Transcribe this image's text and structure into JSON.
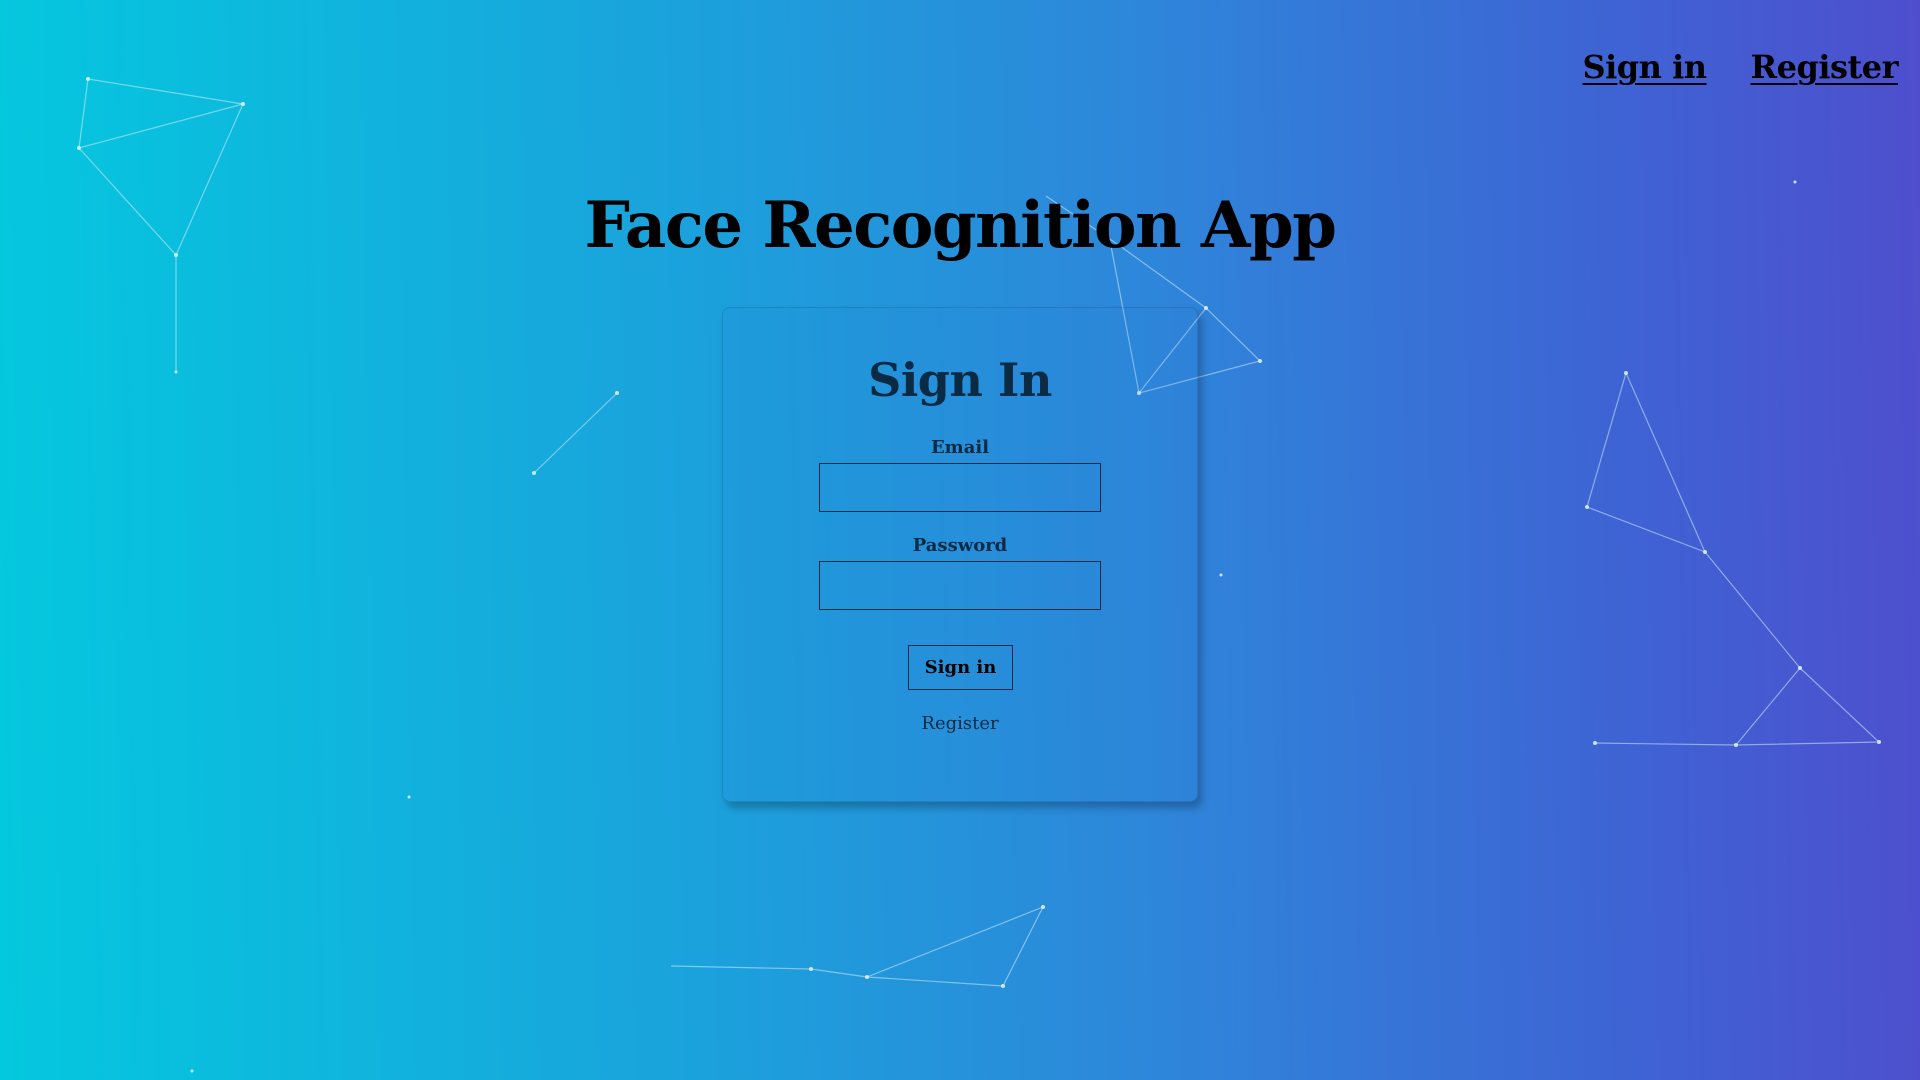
{
  "nav": {
    "signin_label": "Sign in",
    "register_label": "Register"
  },
  "app": {
    "title": "Face Recognition App"
  },
  "signin_form": {
    "heading": "Sign In",
    "email_label": "Email",
    "email_value": "",
    "password_label": "Password",
    "password_value": "",
    "submit_label": "Sign in",
    "register_link_label": "Register"
  },
  "colors": {
    "gradient_start": "#04c8de",
    "gradient_end": "#4e4fcd",
    "particle_line": "#bfe6ff"
  }
}
